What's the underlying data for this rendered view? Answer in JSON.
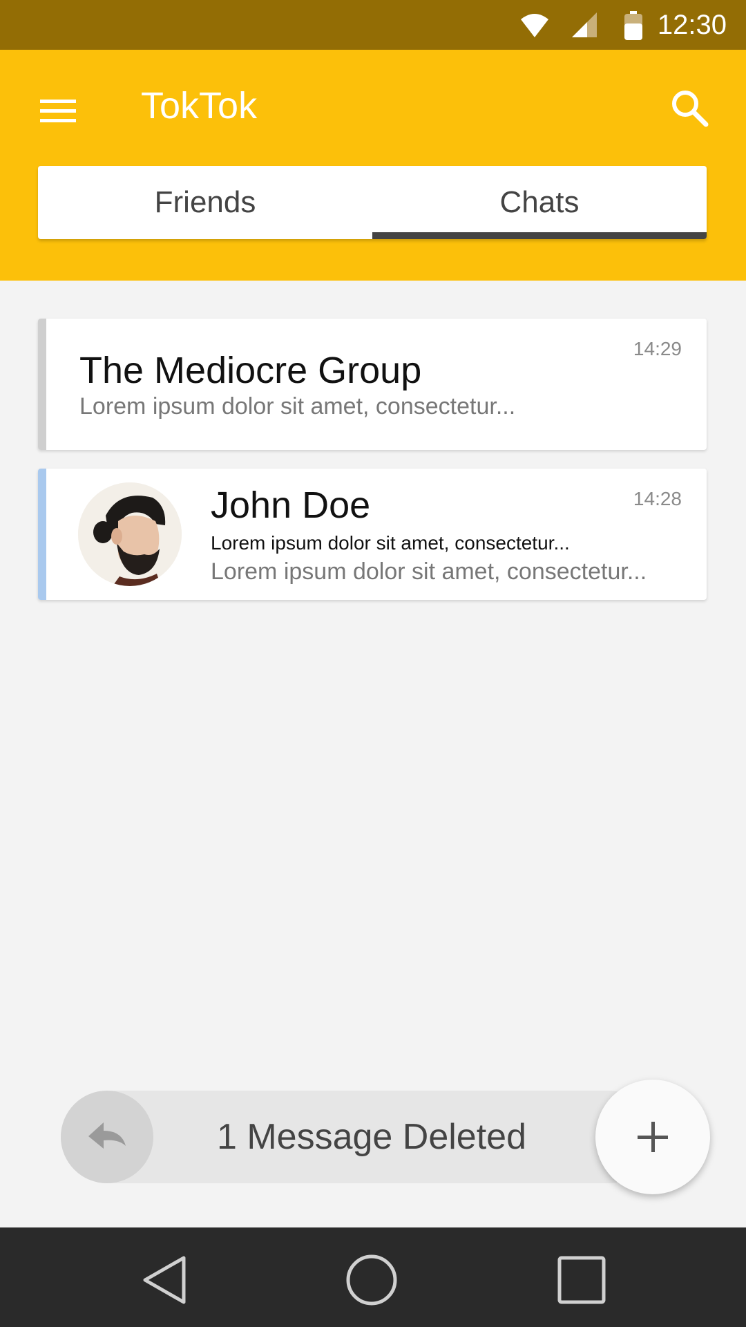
{
  "status_bar": {
    "time": "12:30",
    "icons": [
      "wifi-icon",
      "cell-signal-icon",
      "battery-icon"
    ]
  },
  "app_bar": {
    "title": "TokTok",
    "menu_icon": "menu-icon",
    "search_icon": "search-icon",
    "background_color": "#fcc00a"
  },
  "tabs": [
    {
      "label": "Friends",
      "active": false
    },
    {
      "label": "Chats",
      "active": true
    }
  ],
  "chats": [
    {
      "name": "The Mediocre Group",
      "time": "14:29",
      "message": "Lorem ipsum dolor sit amet, consectetur...",
      "stripe_color": "#cfcfcf"
    },
    {
      "name": "John Doe",
      "time": "14:28",
      "message_bold": "Lorem ipsum dolor sit amet, consectetur...",
      "message": "Lorem ipsum dolor sit amet, consectetur...",
      "stripe_color": "#a9c9ee",
      "avatar": "avatar-photo"
    }
  ],
  "snackbar": {
    "text": "1 Message Deleted",
    "undo_icon": "undo-icon"
  },
  "fab": {
    "icon": "plus-icon"
  },
  "nav_bar": {
    "icons": [
      "back-icon",
      "home-icon",
      "recents-icon"
    ]
  }
}
